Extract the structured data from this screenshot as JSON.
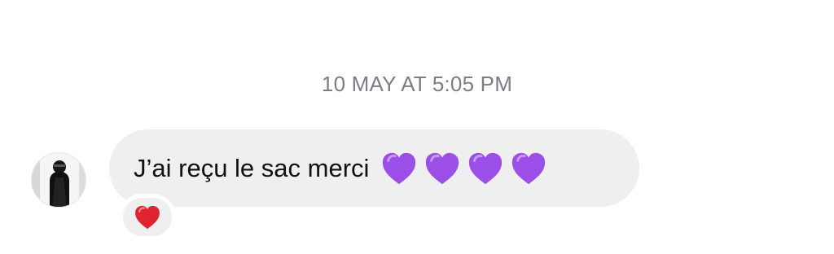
{
  "conversation": {
    "timestamp": "10 MAY AT 5:05 PM"
  },
  "message": {
    "text": "J’ai reçu le sac merci",
    "emojis": [
      "purple-heart",
      "purple-heart",
      "purple-heart",
      "purple-heart"
    ],
    "reaction": "red-heart"
  },
  "colors": {
    "bubble": "#efefef",
    "timestamp": "#7b7f85",
    "purple_heart": "#9b4ee8",
    "red_heart": "#e0232e"
  }
}
